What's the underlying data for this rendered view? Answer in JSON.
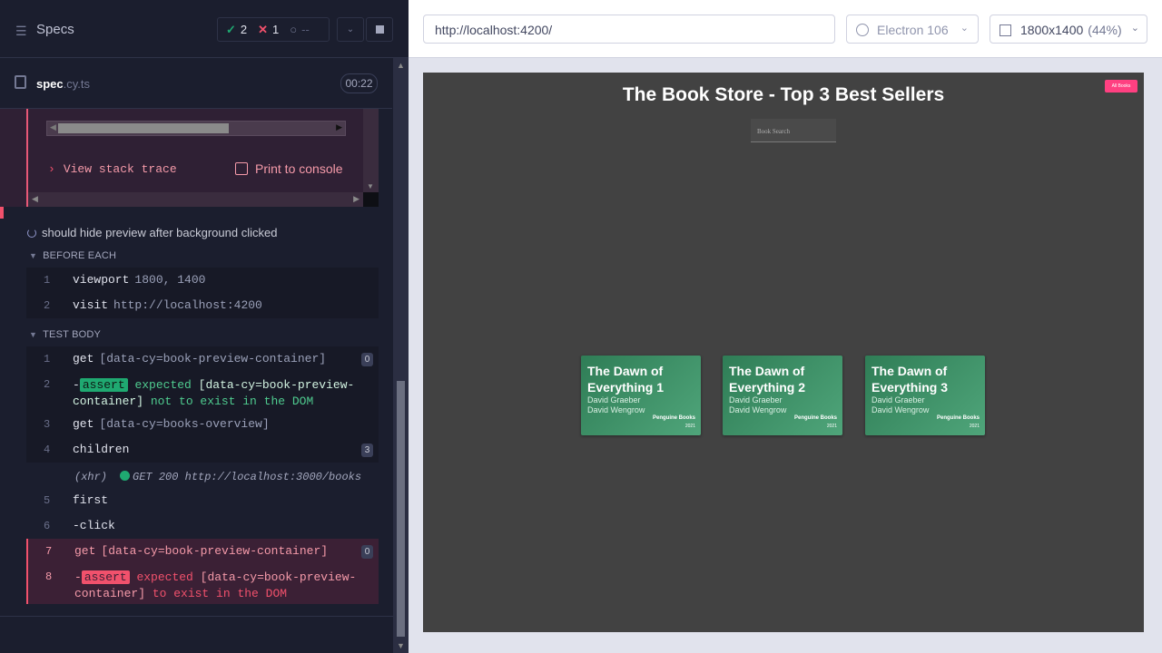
{
  "runner": {
    "header": {
      "title": "Specs",
      "passed": "2",
      "failed": "1",
      "pending": "--"
    },
    "spec": {
      "name": "spec",
      "ext": ".cy.ts",
      "time": "00:22"
    },
    "error": {
      "stack_trace_label": "View stack trace",
      "print_label": "Print to console"
    },
    "test": {
      "title": "should hide preview after background clicked"
    },
    "before_each": {
      "label": "BEFORE EACH",
      "commands": [
        {
          "num": "1",
          "name": "viewport",
          "msg": "1800, 1400"
        },
        {
          "num": "2",
          "name": "visit",
          "msg": "http://localhost:4200"
        }
      ]
    },
    "test_body": {
      "label": "TEST BODY",
      "commands": [
        {
          "num": "1",
          "name": "get",
          "msg": "[data-cy=book-preview-container]",
          "badge": "0"
        },
        {
          "num": "2",
          "prefix": "-",
          "tag": "assert",
          "text": "expected",
          "value": "[data-cy=book-preview-container]",
          "tail": "not to exist in the DOM"
        },
        {
          "num": "3",
          "name": "get",
          "msg": "[data-cy=books-overview]"
        },
        {
          "num": "4",
          "name": "children",
          "badge": "3"
        },
        {
          "xhr": "(xhr)",
          "request": "GET 200 http://localhost:3000/books"
        },
        {
          "num": "5",
          "name": "first"
        },
        {
          "num": "6",
          "name": "-click"
        },
        {
          "num": "7",
          "name": "get",
          "msg": "[data-cy=book-preview-container]",
          "badge": "0"
        },
        {
          "num": "8",
          "prefix": "-",
          "tag": "assert",
          "text": "expected",
          "value": "[data-cy=book-preview-container]",
          "tail": "to exist in the DOM"
        }
      ]
    }
  },
  "browser": {
    "url": "http://localhost:4200/",
    "name": "Electron 106",
    "viewport": "1800x1400",
    "zoom": "(44%)"
  },
  "app": {
    "title": "The Book Store - Top 3 Best Sellers",
    "all_books_button": "All Books",
    "search_placeholder": "Book Search",
    "books": [
      {
        "title": "The Dawn of Everything 1",
        "author1": "David Graeber",
        "author2": "David Wengrow",
        "publisher": "Penguine Books",
        "year": "2021"
      },
      {
        "title": "The Dawn of Everything 2",
        "author1": "David Graeber",
        "author2": "David Wengrow",
        "publisher": "Penguine Books",
        "year": "2021"
      },
      {
        "title": "The Dawn of Everything 3",
        "author1": "David Graeber",
        "author2": "David Wengrow",
        "publisher": "Penguine Books",
        "year": "2021"
      }
    ]
  },
  "colors": {
    "pass": "#1fa971",
    "fail": "#f1516c",
    "accent_pink": "#ff4081",
    "card_green": "#3f9468"
  }
}
